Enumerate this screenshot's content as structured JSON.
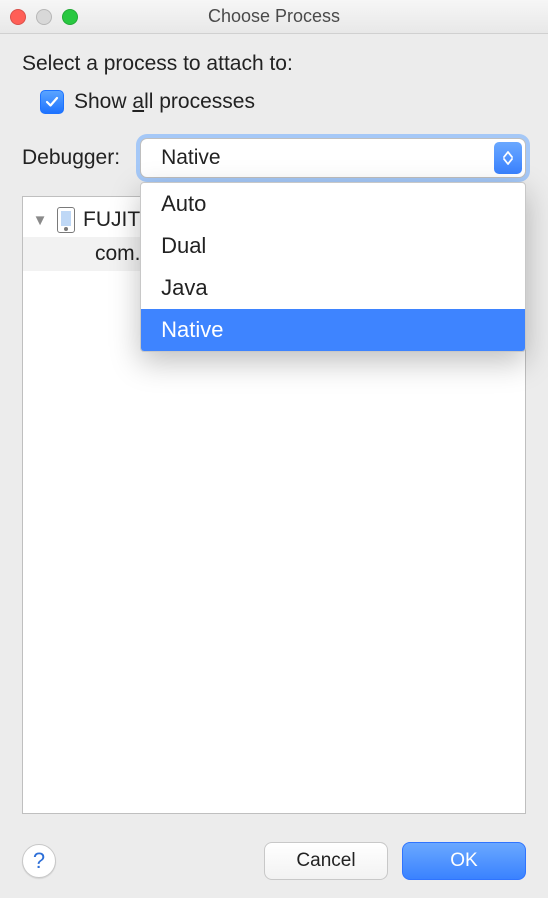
{
  "window": {
    "title": "Choose Process"
  },
  "prompt": "Select a process to attach to:",
  "checkbox": {
    "checked": true,
    "label_pre": "Show ",
    "label_underlined": "a",
    "label_post": "ll processes"
  },
  "debugger": {
    "label": "Debugger:",
    "selected": "Native",
    "options": [
      "Auto",
      "Dual",
      "Java",
      "Native"
    ]
  },
  "tree": {
    "device_label": "FUJITSU M02 Android 5.1.1, API 22",
    "process_label": "com.jp...ybody"
  },
  "footer": {
    "cancel": "Cancel",
    "ok": "OK",
    "help": "?"
  }
}
